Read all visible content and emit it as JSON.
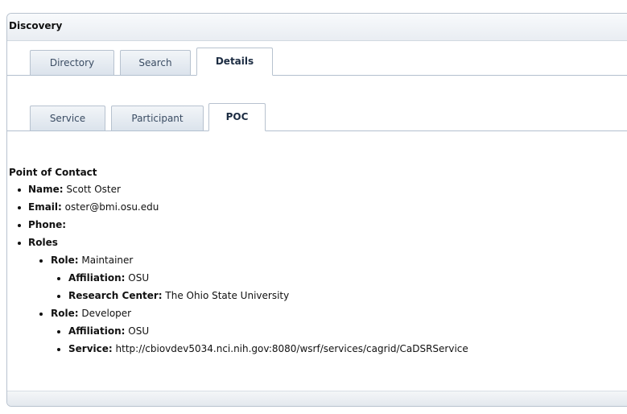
{
  "panel": {
    "title": "Discovery"
  },
  "tabs_main": [
    {
      "label": "Directory",
      "active": false
    },
    {
      "label": "Search",
      "active": false
    },
    {
      "label": "Details",
      "active": true
    }
  ],
  "tabs_details": [
    {
      "label": "Service",
      "active": false
    },
    {
      "label": "Participant",
      "active": false
    },
    {
      "label": "POC",
      "active": true
    }
  ],
  "poc": {
    "heading": "Point of Contact",
    "name_key": "Name:",
    "name_value": "Scott Oster",
    "email_key": "Email:",
    "email_value": "oster@bmi.osu.edu",
    "phone_key": "Phone:",
    "phone_value": "",
    "roles_key": "Roles",
    "roles": [
      {
        "role_key": "Role:",
        "role_value": "Maintainer",
        "affiliation_key": "Affiliation:",
        "affiliation_value": "OSU",
        "extra_key": "Research Center:",
        "extra_value": "The Ohio State University"
      },
      {
        "role_key": "Role:",
        "role_value": "Developer",
        "affiliation_key": "Affiliation:",
        "affiliation_value": "OSU",
        "extra_key": "Service:",
        "extra_value": "http://cbiovdev5034.nci.nih.gov:8080/wsrf/services/cagrid/CaDSRService"
      }
    ]
  },
  "colors": {
    "panel_border": "#b9c3cf",
    "tab_text": "#3a4c63",
    "active_tab_text": "#1c2c42"
  }
}
